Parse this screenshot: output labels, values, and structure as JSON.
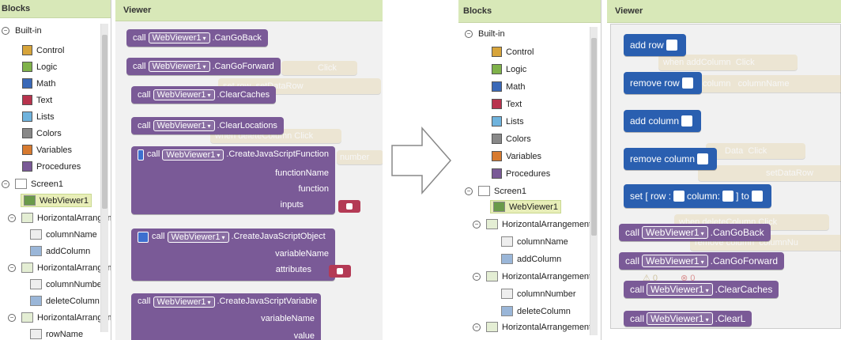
{
  "left": {
    "blocks_header": "Blocks",
    "viewer_header": "Viewer",
    "tree": {
      "builtin": "Built-in",
      "categories": [
        {
          "label": "Control",
          "color": "#d7a43a"
        },
        {
          "label": "Logic",
          "color": "#7fb24a"
        },
        {
          "label": "Math",
          "color": "#3a69b8"
        },
        {
          "label": "Text",
          "color": "#b8334d"
        },
        {
          "label": "Lists",
          "color": "#6fb3dd"
        },
        {
          "label": "Colors",
          "color": "#888888"
        },
        {
          "label": "Variables",
          "color": "#d77a2f"
        },
        {
          "label": "Procedures",
          "color": "#7a5a97"
        }
      ],
      "screen": "Screen1",
      "webviewer": "WebViewer1",
      "ha1": "HorizontalArrangemen",
      "colname": "columnName",
      "addcol": "addColumn",
      "ha2": "HorizontalArrangemen",
      "colnum": "columnNumber",
      "delcol": "deleteColumn",
      "ha3": "HorizontalArrangemen",
      "rowname": "rowName"
    },
    "blocks": {
      "call": "call",
      "comp": "WebViewer1",
      "cangoback": ".CanGoBack",
      "cangoforward": ".CanGoForward",
      "clearcaches": ".ClearCaches",
      "clearlocations": ".ClearLocations",
      "createfn": ".CreateJavaScriptFunction",
      "functionName": "functionName",
      "function": "function",
      "inputs": "inputs",
      "createobj": ".CreateJavaScriptObject",
      "variableName": "variableName",
      "attributes": "attributes",
      "createvar": ".CreateJavaScriptVariable",
      "variableName2": "variableName",
      "value": "value"
    },
    "ghosts": {
      "click": "Click",
      "set": "set",
      "row": "row",
      "setDataRow": "setDataRow",
      "when": "when",
      "deleteColumn": "deleteColumn",
      "number": "number"
    }
  },
  "right": {
    "blocks_header": "Blocks",
    "viewer_header": "Viewer",
    "tree": {
      "builtin": "Built-in",
      "categories": [
        {
          "label": "Control",
          "color": "#d7a43a"
        },
        {
          "label": "Logic",
          "color": "#7fb24a"
        },
        {
          "label": "Math",
          "color": "#3a69b8"
        },
        {
          "label": "Text",
          "color": "#b8334d"
        },
        {
          "label": "Lists",
          "color": "#6fb3dd"
        },
        {
          "label": "Colors",
          "color": "#888888"
        },
        {
          "label": "Variables",
          "color": "#d77a2f"
        },
        {
          "label": "Procedures",
          "color": "#7a5a97"
        }
      ],
      "screen": "Screen1",
      "webviewer": "WebViewer1",
      "ha1": "HorizontalArrangement",
      "colname": "columnName",
      "addcol": "addColumn",
      "ha2": "HorizontalArrangement",
      "colnum": "columnNumber",
      "delcol": "deleteColumn",
      "ha3": "HorizontalArrangement"
    },
    "blocks": {
      "addrow": "add row",
      "removerow": "remove row",
      "addcolumn": "add column",
      "removecolumn": "remove column",
      "set": "set",
      "row": "[ row :",
      "column": "column:",
      "to": "] to",
      "call": "call",
      "comp": "WebViewer1",
      "cangoback": ".CanGoBack",
      "cangoforward": ".CanGoForward",
      "clearcaches": ".ClearCaches",
      "clearloc": ".ClearL"
    },
    "ghosts": {
      "when": "when",
      "addColumn": "addColumn",
      "click": "Click",
      "column": "column",
      "columnName": "columnName",
      "data": "Data",
      "setDataRow": "setDataRow",
      "deleteColumn": "deleteColumn",
      "removecolumn": "remove column",
      "columnNu": "columnNu",
      "zero1": "0",
      "zero2": "0"
    }
  }
}
